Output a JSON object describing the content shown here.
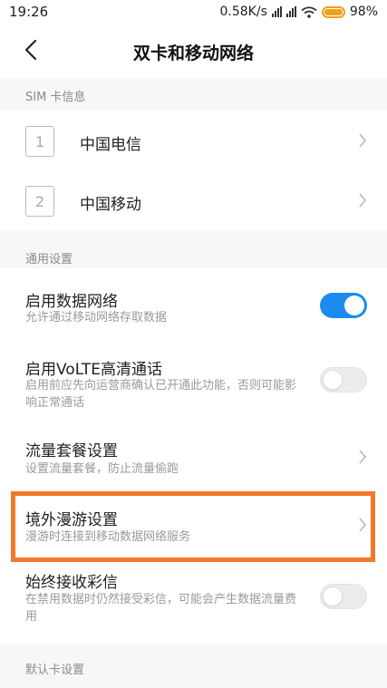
{
  "status_bar": {
    "time": "19:26",
    "network_speed": "0.58K/s",
    "battery_percent": "98%",
    "battery_color": "#f0a020"
  },
  "header": {
    "title": "双卡和移动网络",
    "back_icon": "chevron-left-icon"
  },
  "sim_section": {
    "label": "SIM 卡信息",
    "cards": [
      {
        "slot": "1",
        "name": "中国电信"
      },
      {
        "slot": "2",
        "name": "中国移动"
      }
    ]
  },
  "general_section": {
    "label": "通用设置",
    "items": [
      {
        "title": "启用数据网络",
        "subtitle": "允许通过移动网络存取数据",
        "control": "toggle",
        "enabled": true
      },
      {
        "title": "启用VoLTE高清通话",
        "subtitle": "启用前应先向运营商确认已开通此功能，否则可能影响正常通话",
        "control": "toggle",
        "enabled": false
      },
      {
        "title": "流量套餐设置",
        "subtitle": "设置流量套餐，防止流量偷跑",
        "control": "chevron"
      },
      {
        "title": "境外漫游设置",
        "subtitle": "漫游时连接到移动数据网络服务",
        "control": "chevron",
        "highlighted": true
      },
      {
        "title": "始终接收彩信",
        "subtitle": "在禁用数据时仍然接受彩信，可能会产生数据流量费用",
        "control": "toggle",
        "enabled": false
      }
    ]
  },
  "default_section": {
    "label": "默认卡设置"
  },
  "colors": {
    "accent_toggle": "#1a8cf0",
    "highlight_border": "#f07a2a"
  }
}
